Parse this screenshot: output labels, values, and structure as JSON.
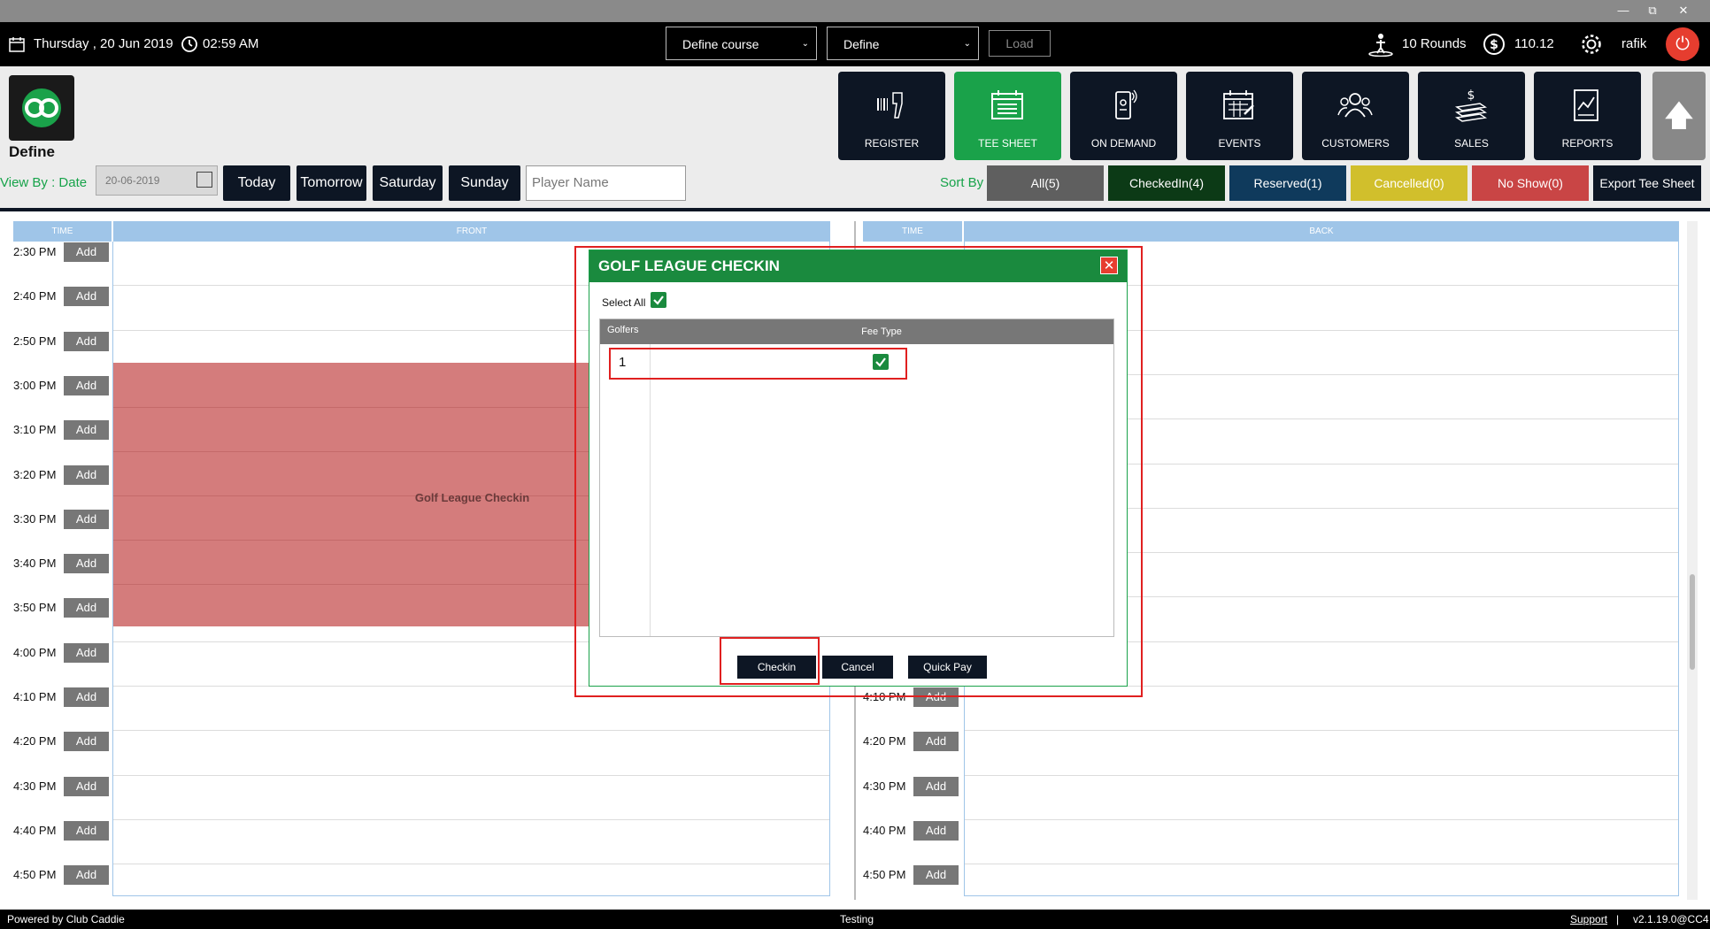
{
  "window": {
    "minimize": "—",
    "restore": "⧉",
    "close": "✕"
  },
  "topbar": {
    "date": "Thursday ,  20 Jun 2019",
    "time": "02:59 AM",
    "course_select": "Define course",
    "define_select": "Define",
    "load_label": "Load",
    "rounds": "10 Rounds",
    "balance": "110.12",
    "user": "rafik"
  },
  "brand": {
    "title": "Define"
  },
  "nav": [
    {
      "label": "REGISTER",
      "icon": "barcode-scanner-icon"
    },
    {
      "label": "TEE SHEET",
      "icon": "tee-sheet-icon"
    },
    {
      "label": "ON DEMAND",
      "icon": "mobile-icon"
    },
    {
      "label": "EVENTS",
      "icon": "calendar-icon"
    },
    {
      "label": "CUSTOMERS",
      "icon": "customers-icon"
    },
    {
      "label": "SALES",
      "icon": "sales-icon"
    },
    {
      "label": "REPORTS",
      "icon": "reports-icon"
    }
  ],
  "filters": {
    "view_by": "View By : Date",
    "date_value": "20-06-2019",
    "days": [
      "Today",
      "Tomorrow",
      "Saturday",
      "Sunday"
    ],
    "player_placeholder": "Player Name",
    "sort_by": "Sort By",
    "status": [
      {
        "label": "All(5)",
        "color": "#5f5f5f"
      },
      {
        "label": "CheckedIn(4)",
        "color": "#0c3a16"
      },
      {
        "label": "Reserved(1)",
        "color": "#0f3a5c"
      },
      {
        "label": "Cancelled(0)",
        "color": "#d1bf2c"
      },
      {
        "label": "No Show(0)",
        "color": "#c94545"
      }
    ],
    "export": "Export Tee Sheet"
  },
  "grid": {
    "time_header": "TIME",
    "front_header": "FRONT",
    "back_header": "BACK",
    "add_label": "Add",
    "front_times": [
      "2:30 PM",
      "2:40 PM",
      "2:50 PM",
      "3:00 PM",
      "3:10 PM",
      "3:20 PM",
      "3:30 PM",
      "3:40 PM",
      "3:50 PM",
      "4:00 PM",
      "4:10 PM",
      "4:20 PM",
      "4:30 PM",
      "4:40 PM",
      "4:50 PM"
    ],
    "back_times": [
      "4:10 PM",
      "4:20 PM",
      "4:30 PM",
      "4:40 PM",
      "4:50 PM"
    ],
    "booking_label": "Golf League Checkin"
  },
  "modal": {
    "title": "GOLF LEAGUE CHECKIN",
    "select_all": "Select All",
    "col_golfers": "Golfers",
    "col_fee_type": "Fee Type",
    "row_number": "1",
    "checkin": "Checkin",
    "cancel": "Cancel",
    "quick_pay": "Quick Pay"
  },
  "footer": {
    "powered": "Powered by Club Caddie",
    "env": "Testing",
    "support": "Support",
    "sep": "|",
    "version": "v2.1.19.0@CC4"
  }
}
